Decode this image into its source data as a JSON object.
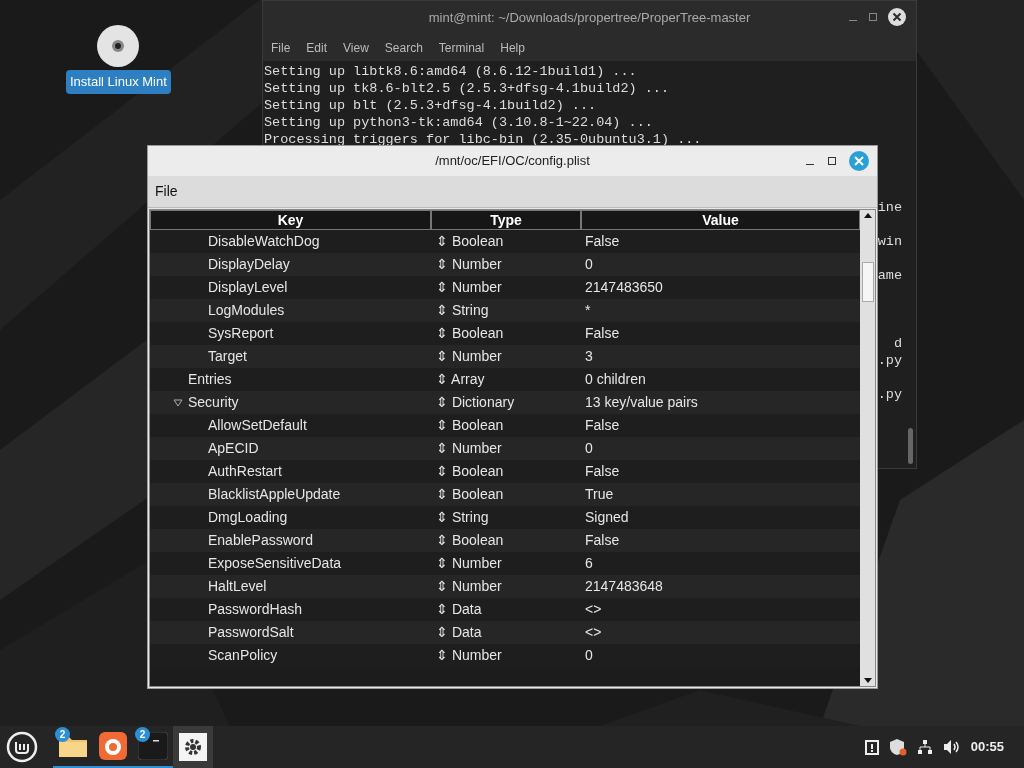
{
  "desktop": {
    "icons": [
      {
        "label": "Install Linux Mint",
        "selected": true
      }
    ]
  },
  "terminal": {
    "title": "mint@mint: ~/Downloads/propertree/ProperTree-master",
    "menu": [
      "File",
      "Edit",
      "View",
      "Search",
      "Terminal",
      "Help"
    ],
    "lines": [
      "Setting up libtk8.6:amd64 (8.6.12-1build1) ...",
      "Setting up tk8.6-blt2.5 (2.5.3+dfsg-4.1build2) ...",
      "Setting up blt (2.5.3+dfsg-4.1build2) ...",
      "Setting up python3-tk:amd64 (3.10.8-1~22.04) ...",
      "Processing triggers for libc-bin (2.35-0ubuntu3.1) ..."
    ],
    "fragments": [
      "ine",
      "win",
      "ame",
      "d",
      ".py",
      ".py"
    ]
  },
  "plist_window": {
    "title": "/mnt/oc/EFI/OC/config.plist",
    "menu": [
      "File"
    ],
    "columns": [
      "Key",
      "Type",
      "Value"
    ],
    "tree": [
      {
        "kind": "continued",
        "children": [
          {
            "kind": "row",
            "key": "DisableWatchDog",
            "type": "⇕ Boolean",
            "value": "False"
          },
          {
            "kind": "row",
            "key": "DisplayDelay",
            "type": "⇕ Number",
            "value": "0"
          },
          {
            "kind": "row",
            "key": "DisplayLevel",
            "type": "⇕ Number",
            "value": "2147483650"
          },
          {
            "kind": "row",
            "key": "LogModules",
            "type": "⇕ String",
            "value": "*"
          },
          {
            "kind": "row",
            "key": "SysReport",
            "type": "⇕ Boolean",
            "value": "False"
          },
          {
            "kind": "row",
            "key": "Target",
            "type": "⇕ Number",
            "value": "3"
          }
        ]
      },
      {
        "kind": "row",
        "key": "Entries",
        "type": "⇕ Array",
        "value": "0 children"
      },
      {
        "kind": "row",
        "key": "Security",
        "type": "⇕ Dictionary",
        "value": "13 key/value pairs",
        "expanded": true,
        "children": [
          {
            "kind": "row",
            "key": "AllowSetDefault",
            "type": "⇕ Boolean",
            "value": "False"
          },
          {
            "kind": "row",
            "key": "ApECID",
            "type": "⇕ Number",
            "value": "0"
          },
          {
            "kind": "row",
            "key": "AuthRestart",
            "type": "⇕ Boolean",
            "value": "False"
          },
          {
            "kind": "row",
            "key": "BlacklistAppleUpdate",
            "type": "⇕ Boolean",
            "value": "True"
          },
          {
            "kind": "row",
            "key": "DmgLoading",
            "type": "⇕ String",
            "value": "Signed"
          },
          {
            "kind": "row",
            "key": "EnablePassword",
            "type": "⇕ Boolean",
            "value": "False"
          },
          {
            "kind": "row",
            "key": "ExposeSensitiveData",
            "type": "⇕ Number",
            "value": "6"
          },
          {
            "kind": "row",
            "key": "HaltLevel",
            "type": "⇕ Number",
            "value": "2147483648"
          },
          {
            "kind": "row",
            "key": "PasswordHash",
            "type": "⇕ Data",
            "value": "<>"
          },
          {
            "kind": "row",
            "key": "PasswordSalt",
            "type": "⇕ Data",
            "value": "<>"
          },
          {
            "kind": "row",
            "key": "ScanPolicy",
            "type": "⇕ Number",
            "value": "0"
          }
        ]
      }
    ]
  },
  "taskbar": {
    "apps": [
      {
        "kind": "files",
        "badge": "2",
        "active": false
      },
      {
        "kind": "browser",
        "active": false
      },
      {
        "kind": "terminal",
        "badge": "2",
        "active": false
      },
      {
        "kind": "settings",
        "active": true
      }
    ],
    "clock": "00:55"
  }
}
